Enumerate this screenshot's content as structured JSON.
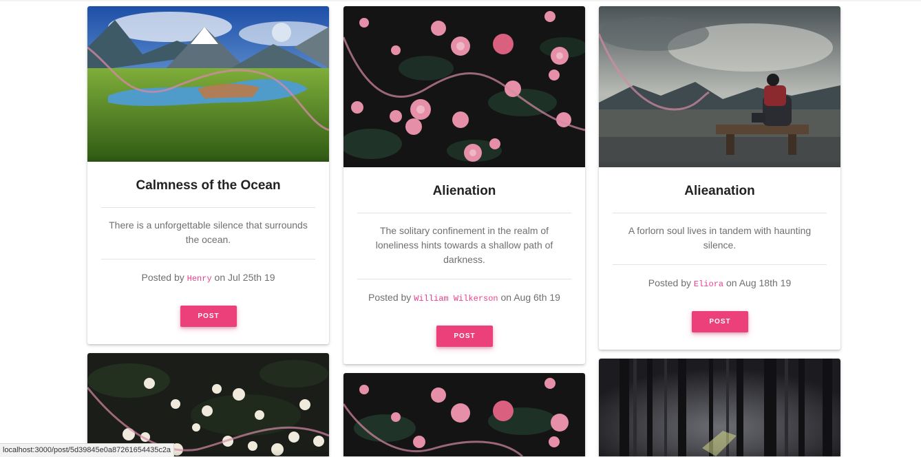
{
  "cards": [
    {
      "title": "Calmness of the Ocean",
      "description": "There is a unforgettable silence that surrounds the ocean.",
      "posted_prefix": "Posted by",
      "author": "Henry",
      "date_prefix": "on",
      "date": "Jul 25th 19",
      "button_label": "POST",
      "image": "mountain-lake-landscape"
    },
    {
      "title": "Alienation",
      "description": "The solitary confinement in the realm of loneliness hints towards a shallow path of darkness.",
      "posted_prefix": "Posted by",
      "author": "William Wilkerson",
      "date_prefix": "on",
      "date": "Aug 6th 19",
      "button_label": "POST",
      "image": "pink-flowers-dark"
    },
    {
      "title": "Alieanation",
      "description": "A forlorn soul lives in tandem with haunting silence.",
      "posted_prefix": "Posted by",
      "author": "Eliora",
      "date_prefix": "on",
      "date": "Aug 18th 19",
      "button_label": "POST",
      "image": "person-on-bench-mountains"
    },
    {
      "image": "white-flowers-dark"
    },
    {
      "image": "pink-flowers-dark"
    },
    {
      "image": "foggy-forest"
    }
  ],
  "status_url": "localhost:3000/post/5d39845e0a87261654435c2a",
  "colors": {
    "accent": "#ec407a",
    "author": "#e83e8c"
  }
}
